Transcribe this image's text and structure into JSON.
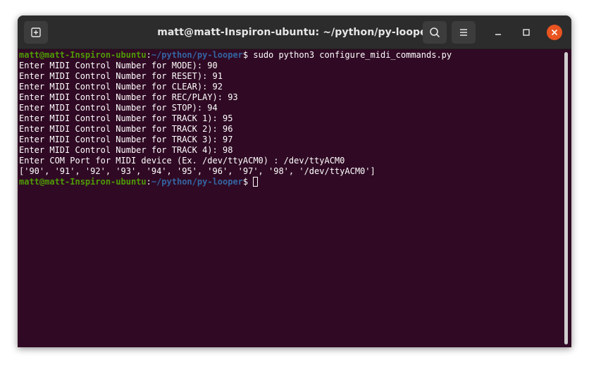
{
  "window": {
    "title": "matt@matt-Inspiron-ubuntu: ~/python/py-looper"
  },
  "icons": {
    "new_tab": "new-tab-icon",
    "search": "search-icon",
    "menu": "hamburger-menu-icon",
    "minimize": "minimize-icon",
    "maximize": "maximize-icon",
    "close": "close-icon"
  },
  "colors": {
    "terminal_bg": "#300a24",
    "prompt_user": "#4e9a06",
    "prompt_path": "#3465a4",
    "close_button": "#e95420"
  },
  "terminal": {
    "prompt1": {
      "user": "matt@matt-Inspiron-ubuntu",
      "sep": ":",
      "path": "~/python/py-looper",
      "symbol": "$",
      "command": " sudo python3 configure_midi_commands.py"
    },
    "lines": [
      "Enter MIDI Control Number for MODE): 90",
      "Enter MIDI Control Number for RESET): 91",
      "Enter MIDI Control Number for CLEAR): 92",
      "Enter MIDI Control Number for REC/PLAY): 93",
      "Enter MIDI Control Number for STOP): 94",
      "Enter MIDI Control Number for TRACK 1): 95",
      "Enter MIDI Control Number for TRACK 2): 96",
      "Enter MIDI Control Number for TRACK 3): 97",
      "Enter MIDI Control Number for TRACK 4): 98",
      "Enter COM Port for MIDI device (Ex. /dev/ttyACM0) : /dev/ttyACM0",
      "['90', '91', '92', '93', '94', '95', '96', '97', '98', '/dev/ttyACM0']"
    ],
    "prompt2": {
      "user": "matt@matt-Inspiron-ubuntu",
      "sep": ":",
      "path": "~/python/py-looper",
      "symbol": "$ ",
      "command": ""
    }
  }
}
